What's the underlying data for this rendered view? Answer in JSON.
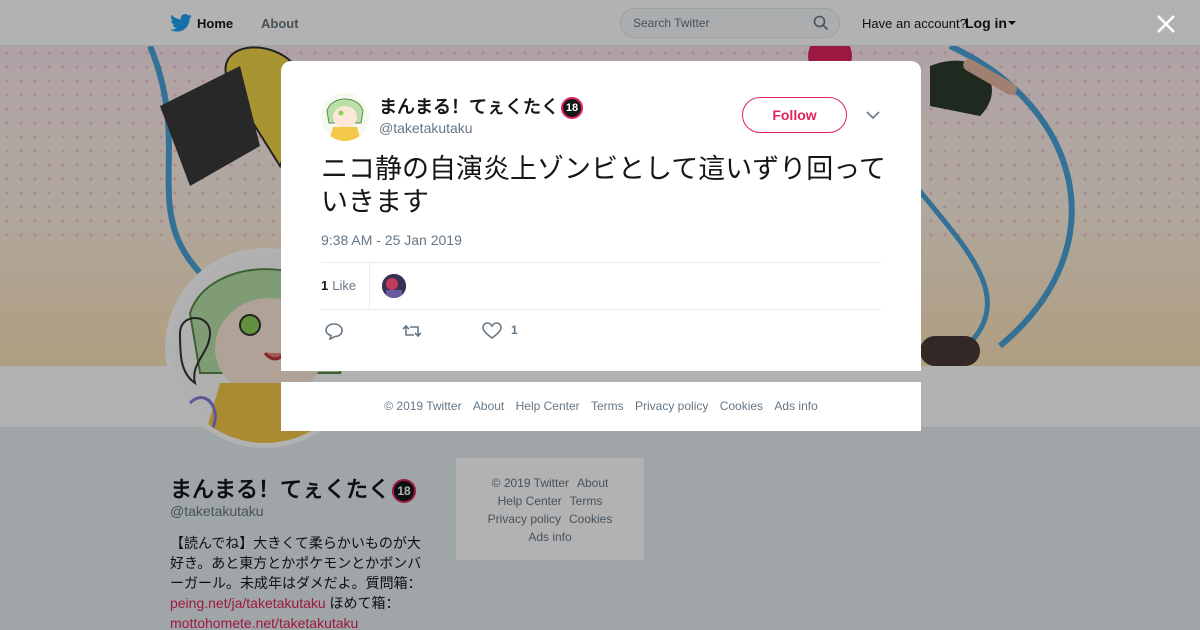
{
  "nav": {
    "home": "Home",
    "about": "About",
    "search_placeholder": "Search Twitter",
    "have_account": "Have an account?",
    "login": "Log in"
  },
  "profile": {
    "name": "まんまる！てぇくたく",
    "age_badge": "18",
    "handle": "@taketakutaku",
    "bio_1": "【読んでね】大きくて柔らかいものが大好き。あと東方とかポケモンとかボンバーガール。未成年はダメだよ。質問箱：",
    "bio_link_1": "peing.net/ja/taketakutaku",
    "bio_2": " ほめて箱：",
    "bio_link_2": "mottohomete.net/taketakutaku"
  },
  "page_footer": {
    "copyright": "© 2019 Twitter",
    "about": "About",
    "help": "Help Center",
    "terms": "Terms",
    "privacy": "Privacy policy",
    "cookies": "Cookies",
    "ads": "Ads info"
  },
  "tweet": {
    "name": "まんまる！てぇくたく",
    "age_badge": "18",
    "handle": "@taketakutaku",
    "follow": "Follow",
    "text": "ニコ静の自演炎上ゾンビとして這いずり回っていきます",
    "time": "9:38 AM - 25 Jan 2019",
    "likes_count": "1",
    "likes_label": "Like",
    "action_like_count": "1"
  },
  "modal_footer": {
    "copyright": "© 2019 Twitter",
    "about": "About",
    "help": "Help Center",
    "terms": "Terms",
    "privacy": "Privacy policy",
    "cookies": "Cookies",
    "ads": "Ads info"
  },
  "colors": {
    "accent": "#e0245e",
    "twitter_blue": "#1da1f2",
    "muted": "#657786"
  }
}
